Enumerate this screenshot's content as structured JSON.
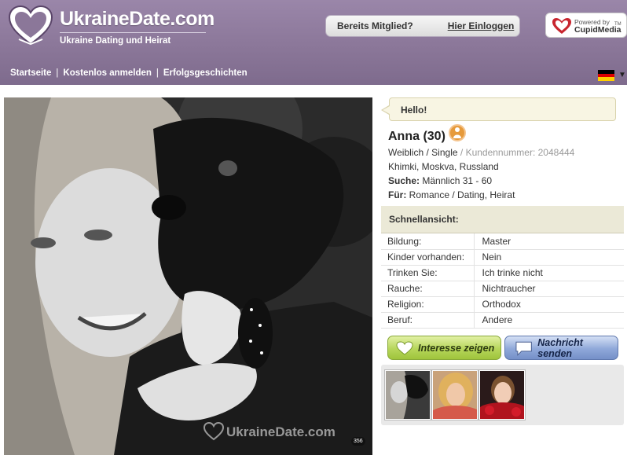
{
  "site": {
    "logo_main": "UkraineDate.com",
    "logo_sub": "Ukraine Dating und Heirat"
  },
  "login": {
    "question": "Bereits Mitglied?",
    "link": "Hier Einloggen"
  },
  "powered": {
    "line1": "Powered by",
    "brand": "CupidMedia",
    "tm": "TM"
  },
  "nav": {
    "items": [
      "Startseite",
      "Kostenlos anmelden",
      "Erfolgsgeschichten"
    ],
    "separator": "|"
  },
  "language": {
    "flag_colors": [
      "#000000",
      "#dd0000",
      "#ffce00"
    ],
    "arrow": "▼"
  },
  "photo": {
    "watermark": "UkraineDate.com",
    "number": "356"
  },
  "profile": {
    "greeting": "Hello!",
    "name_age": "Anna (30)",
    "gender": "Weiblich",
    "status": "Single",
    "slash": "/",
    "customer_label": "Kundennummer:",
    "customer_number": "2048444",
    "location": "Khimki, Moskva, Russland",
    "search_label": "Suche:",
    "search_value": "Männlich 31 - 60",
    "for_label": "Für:",
    "for_value": "Romance / Dating, Heirat"
  },
  "quick_view": {
    "title": "Schnellansicht:",
    "rows": [
      {
        "key": "Bildung:",
        "value": "Master"
      },
      {
        "key": "Kinder vorhanden:",
        "value": "Nein"
      },
      {
        "key": "Trinken Sie:",
        "value": "Ich trinke nicht"
      },
      {
        "key": "Rauche:",
        "value": "Nichtraucher"
      },
      {
        "key": "Religion:",
        "value": "Orthodox"
      },
      {
        "key": "Beruf:",
        "value": "Andere"
      }
    ]
  },
  "actions": {
    "interest": "Interesse zeigen",
    "message": "Nachricht senden"
  },
  "colors": {
    "header": "#8b7799",
    "accent_orange": "#e69a3b"
  }
}
